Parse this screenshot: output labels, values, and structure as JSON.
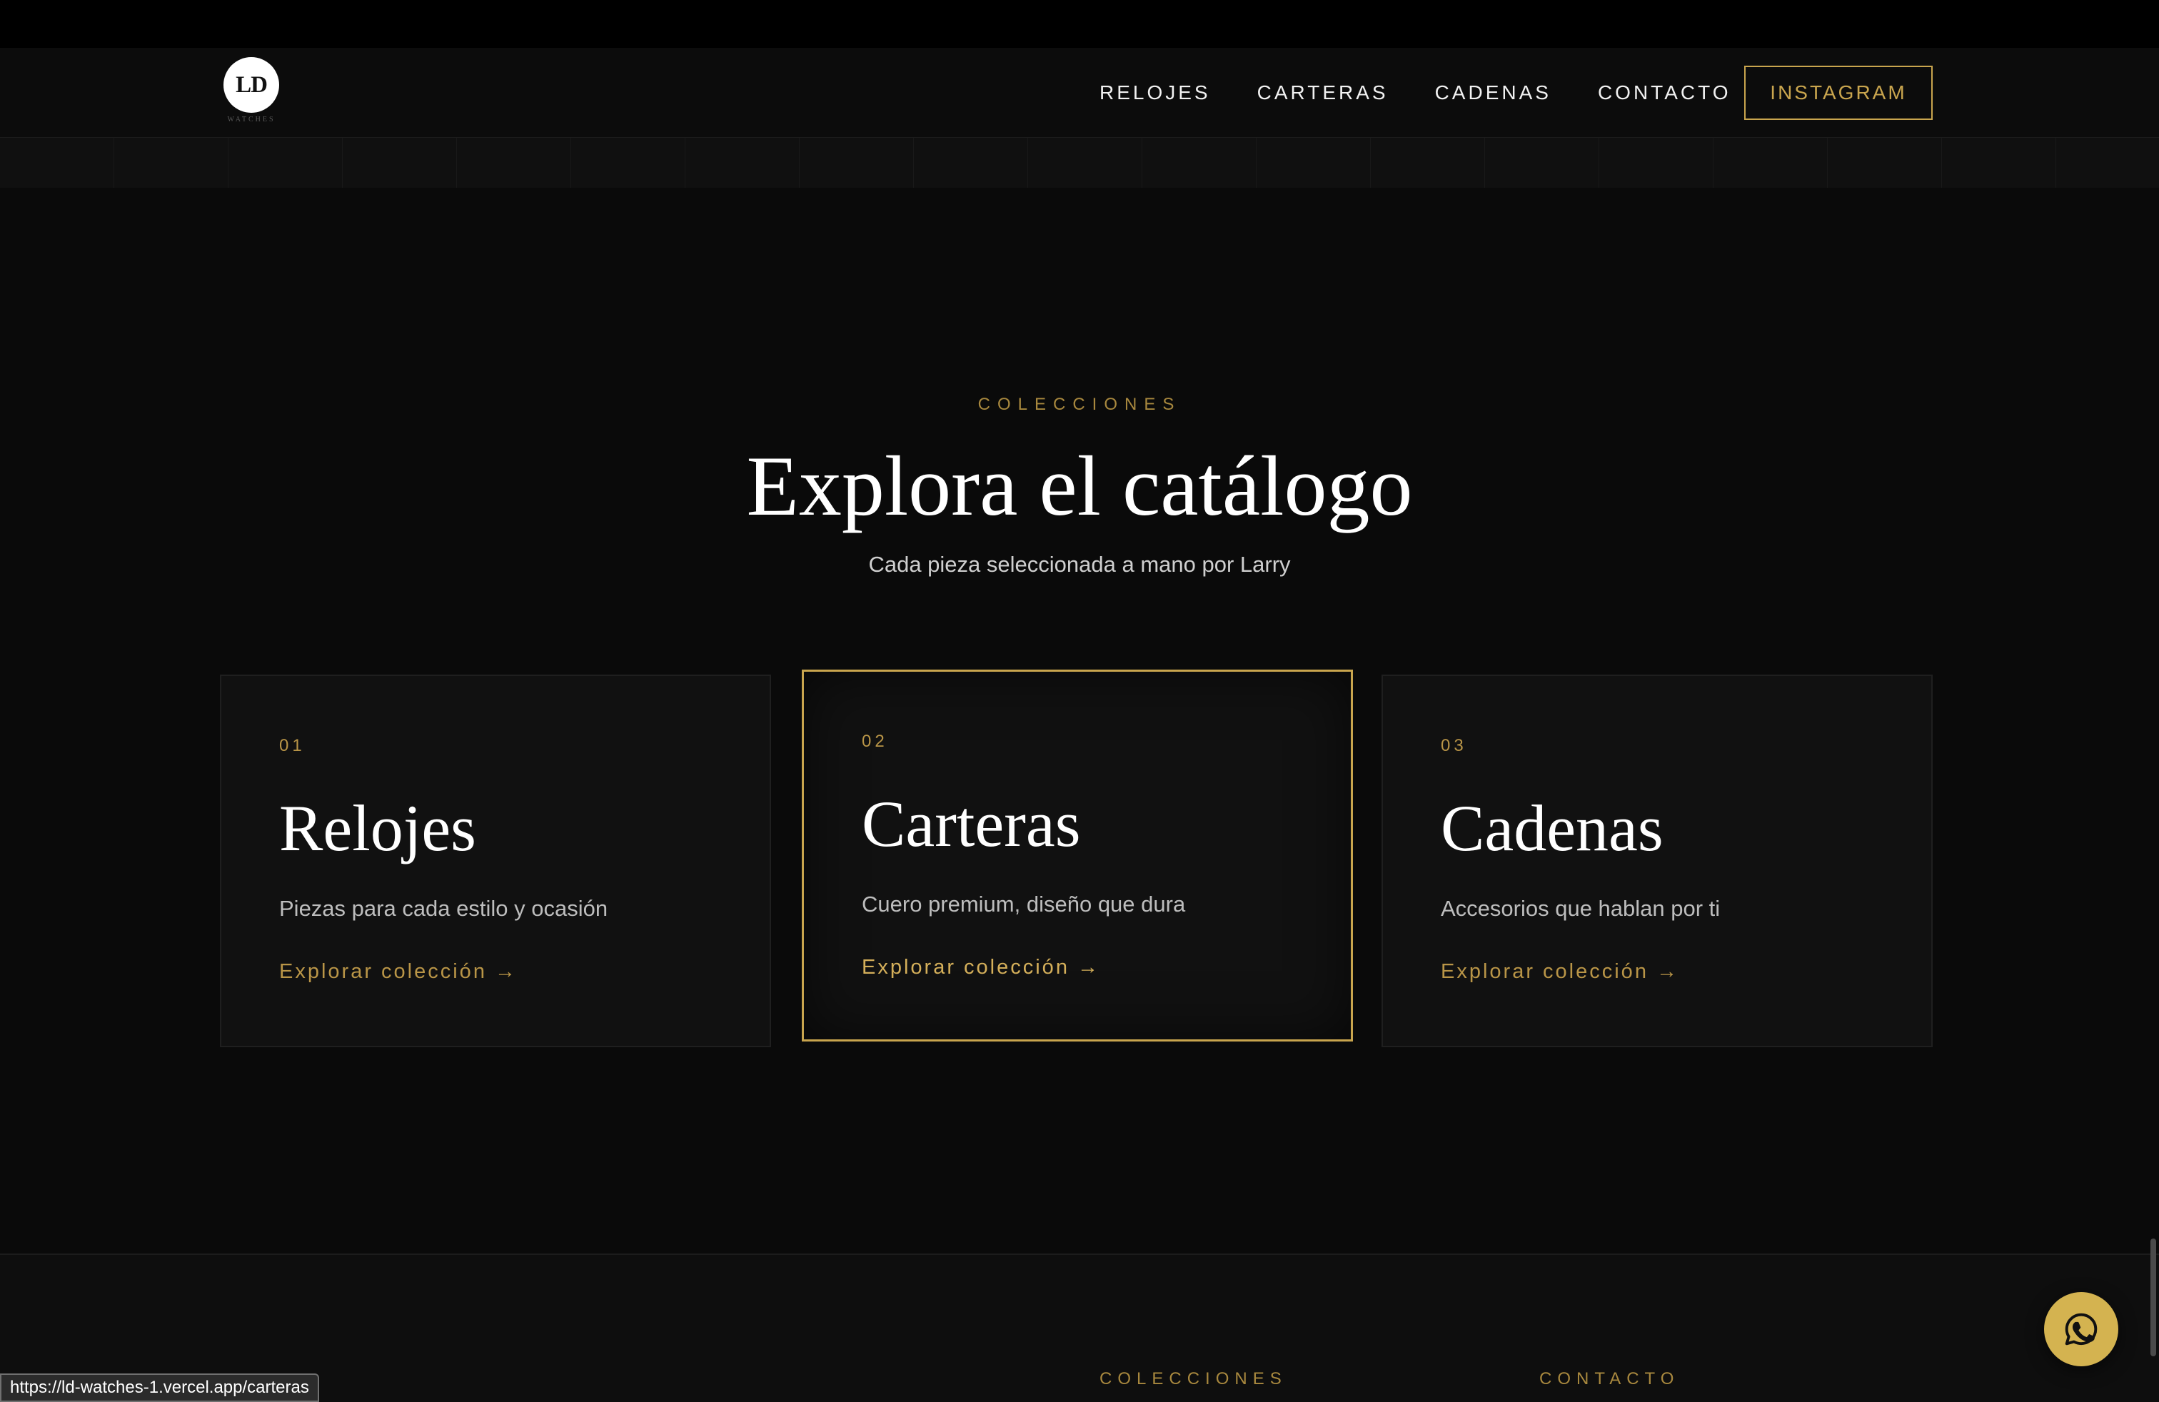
{
  "brand": {
    "logo_mark": "LD",
    "logo_sub": "WATCHES"
  },
  "nav": {
    "items": [
      {
        "label": "RELOJES"
      },
      {
        "label": "CARTERAS"
      },
      {
        "label": "CADENAS"
      },
      {
        "label": "CONTACTO"
      }
    ],
    "cta_label": "INSTAGRAM"
  },
  "collections": {
    "eyebrow": "COLECCIONES",
    "title": "Explora el catálogo",
    "subtitle": "Cada pieza seleccionada a mano por Larry",
    "cards": [
      {
        "number": "01",
        "title": "Relojes",
        "description": "Piezas para cada estilo y ocasión",
        "link": "Explorar colección →",
        "active": false
      },
      {
        "number": "02",
        "title": "Carteras",
        "description": "Cuero premium, diseño que dura",
        "link": "Explorar colección →",
        "active": true
      },
      {
        "number": "03",
        "title": "Cadenas",
        "description": "Accesorios que hablan por ti",
        "link": "Explorar colección →",
        "active": false
      }
    ]
  },
  "footer": {
    "col1_heading": "COLECCIONES",
    "col2_heading": "CONTACTO"
  },
  "status_bar": {
    "url": "https://ld-watches-1.vercel.app/carteras"
  },
  "colors": {
    "background": "#0a0a0a",
    "accent_gold": "#c9a54e",
    "whatsapp_button": "#d4b350"
  },
  "icons": {
    "floating_button": "whatsapp-icon"
  }
}
